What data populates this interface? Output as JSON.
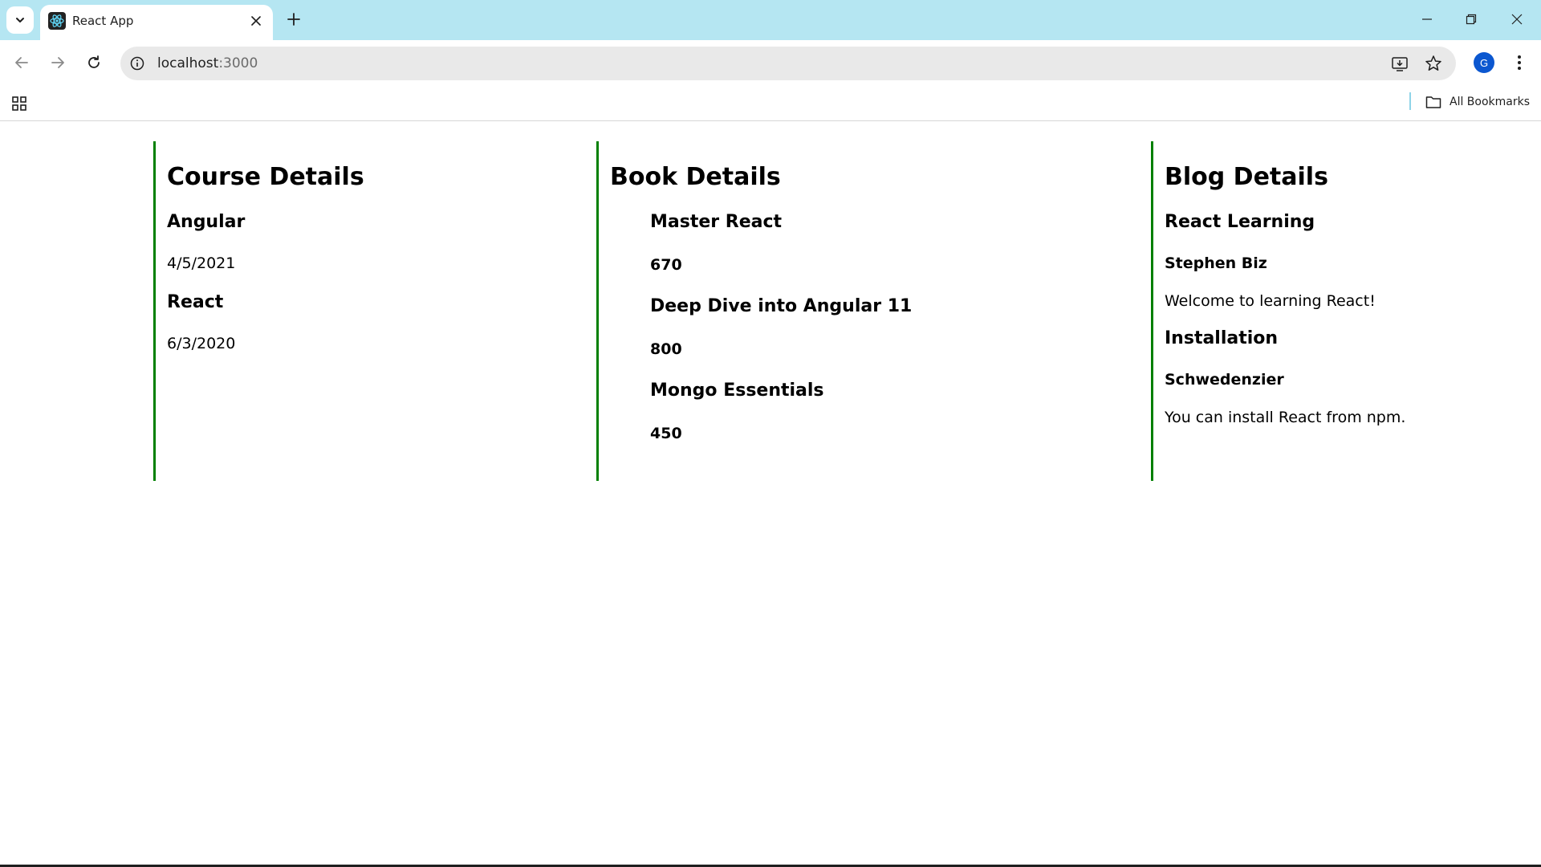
{
  "browser": {
    "tab": {
      "title": "React App",
      "favicon": "react-logo-icon"
    },
    "address_bar": {
      "host": "localhost",
      "port": ":3000"
    },
    "profile_initial": "G",
    "bookmarks_bar": {
      "all_bookmarks_label": "All Bookmarks"
    },
    "colors": {
      "tabstrip": "#b5e6f2",
      "avatar": "#0b57d0"
    }
  },
  "page": {
    "accent_color": "#008000",
    "course": {
      "heading": "Course Details",
      "items": [
        {
          "name": "Angular",
          "date": "4/5/2021"
        },
        {
          "name": "React",
          "date": "6/3/2020"
        }
      ]
    },
    "books": {
      "heading": "Book Details",
      "items": [
        {
          "name": "Master React",
          "price": "670"
        },
        {
          "name": "Deep Dive into Angular 11",
          "price": "800"
        },
        {
          "name": "Mongo Essentials",
          "price": "450"
        }
      ]
    },
    "blogs": {
      "heading": "Blog Details",
      "items": [
        {
          "title": "React Learning",
          "author": "Stephen Biz",
          "content": "Welcome to learning React!"
        },
        {
          "title": "Installation",
          "author": "Schwedenzier",
          "content": "You can install React from npm."
        }
      ]
    }
  }
}
